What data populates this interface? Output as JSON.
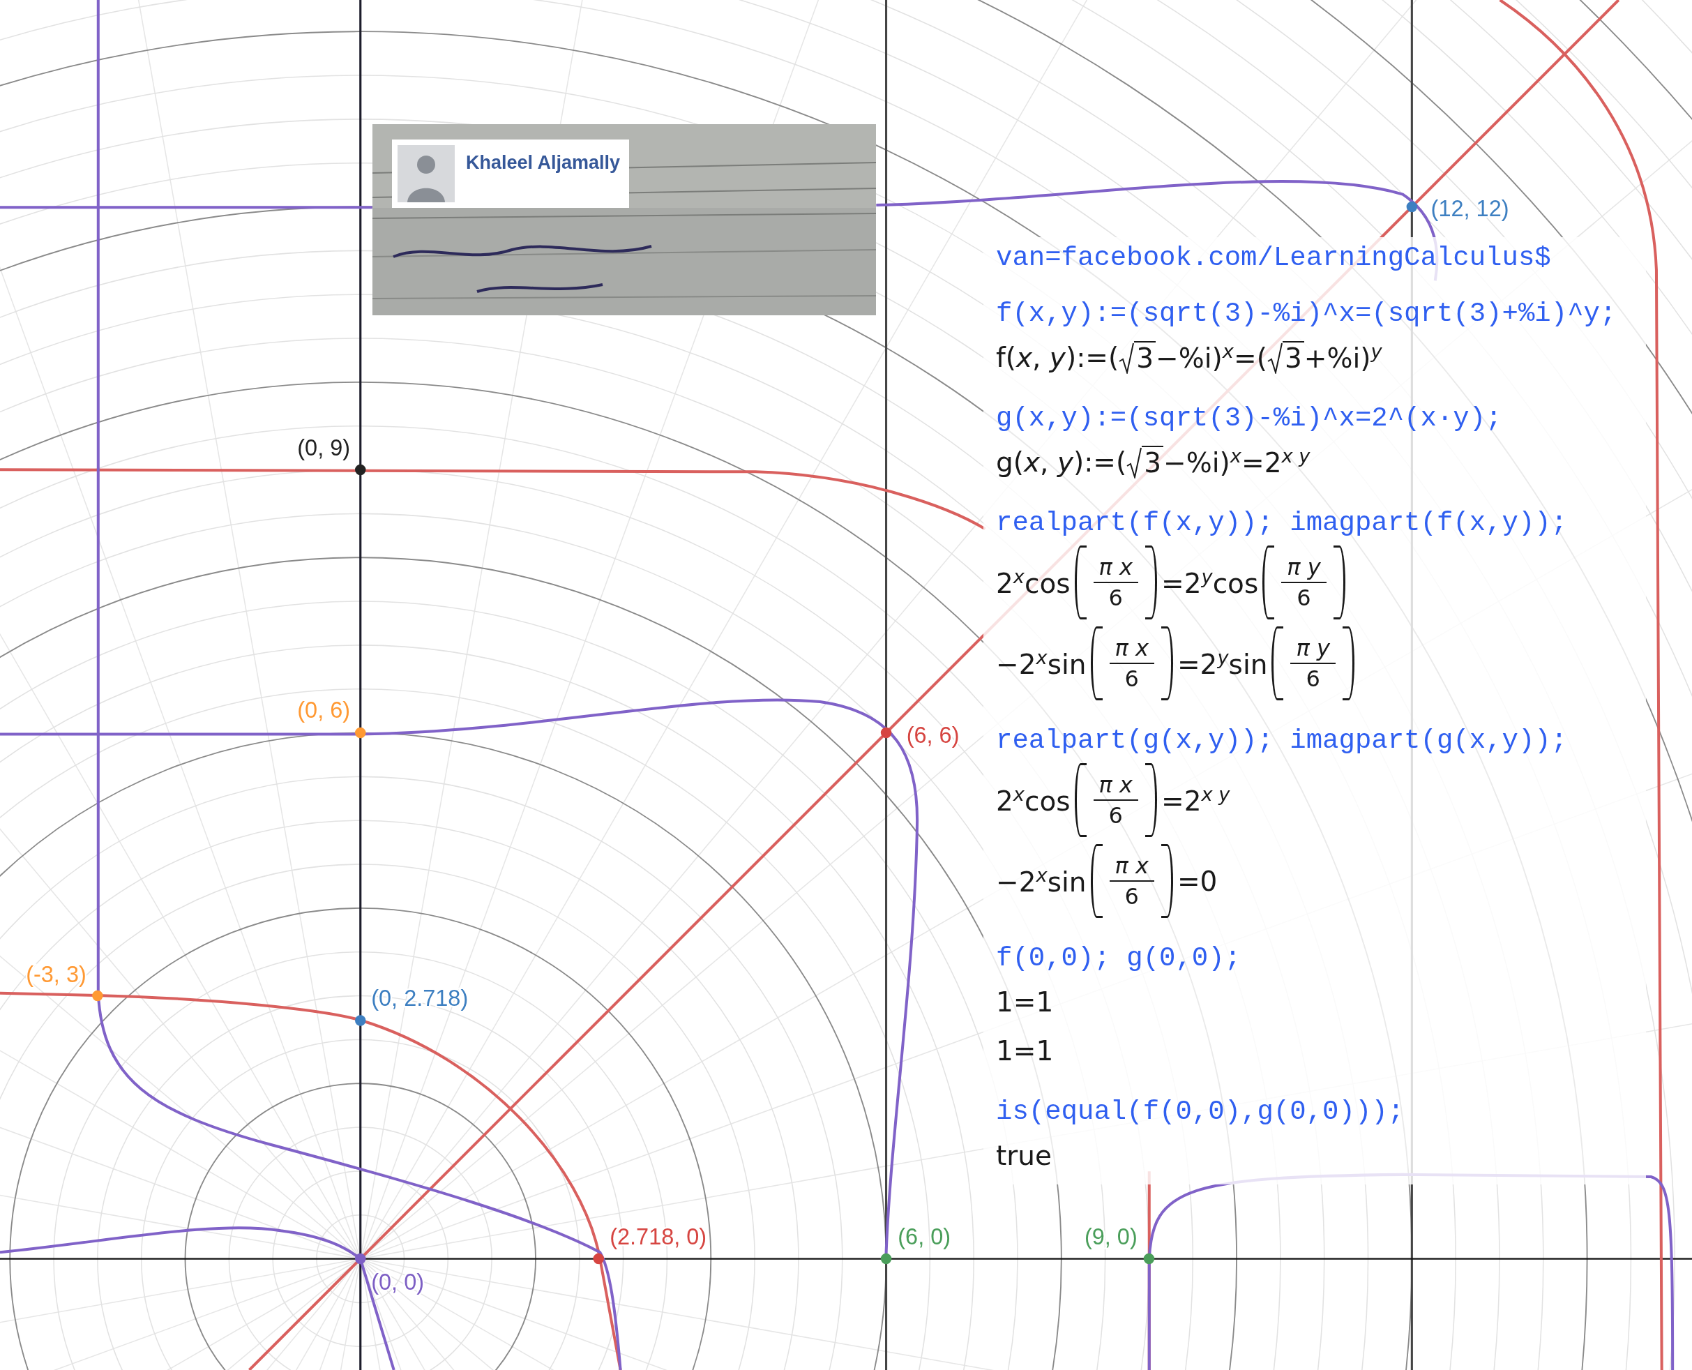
{
  "inset": {
    "kind": "picture",
    "author": {
      "name": "Khaleel Aljamally"
    }
  },
  "points": [
    {
      "label": "(0, 9)",
      "color": "#222222"
    },
    {
      "label": "(0, 6)",
      "color": "#ff9933"
    },
    {
      "label": "(6, 6)",
      "color": "#d64541"
    },
    {
      "label": "(12, 12)",
      "color": "#3d7fc1"
    },
    {
      "label": "(-3, 3)",
      "color": "#ff9933"
    },
    {
      "label": "(0, 2.718)",
      "color": "#3d7fc1"
    },
    {
      "label": "(2.718, 0)",
      "color": "#d64541"
    },
    {
      "label": "(0, 0)",
      "color": "#7d5fc4"
    },
    {
      "label": "(6, 0)",
      "color": "#4a9e5a"
    },
    {
      "label": "(9, 0)",
      "color": "#4a9e5a"
    }
  ],
  "session": [
    {
      "input": "van=facebook.com/LearningCalculus$"
    },
    {
      "input": "f(x,y):=(sqrt(3)-%i)^x=(sqrt(3)+%i)^y;",
      "outputs": [
        [
          {
            "kind": "text",
            "text": "f(*x*, *y*):=("
          },
          {
            "kind": "sqrt",
            "radicand": "3"
          },
          {
            "kind": "text",
            "text": "−%i)$^{x}$=("
          },
          {
            "kind": "sqrt",
            "radicand": "3"
          },
          {
            "kind": "text",
            "text": "+%i)$^{y}$"
          }
        ]
      ]
    },
    {
      "input": "g(x,y):=(sqrt(3)-%i)^x=2^(x·y);",
      "outputs": [
        [
          {
            "kind": "text",
            "text": "g(*x*, *y*):=("
          },
          {
            "kind": "sqrt",
            "radicand": "3"
          },
          {
            "kind": "text",
            "text": "−%i)$^{x}$=2$^{x y}$"
          }
        ]
      ]
    },
    {
      "input": "realpart(f(x,y)); imagpart(f(x,y));",
      "outputs": [
        [
          {
            "kind": "text",
            "text": "2$^{x}$cos"
          },
          {
            "kind": "frac",
            "num": "π x",
            "den": "6"
          },
          {
            "kind": "text",
            "text": "=2$^{y}$cos"
          },
          {
            "kind": "frac",
            "num": "π y",
            "den": "6"
          }
        ],
        [
          {
            "kind": "text",
            "text": "−2$^{x}$sin"
          },
          {
            "kind": "frac",
            "num": "π x",
            "den": "6"
          },
          {
            "kind": "text",
            "text": "=2$^{y}$sin"
          },
          {
            "kind": "frac",
            "num": "π y",
            "den": "6"
          }
        ]
      ]
    },
    {
      "input": "realpart(g(x,y)); imagpart(g(x,y));",
      "outputs": [
        [
          {
            "kind": "text",
            "text": "2$^{x}$cos"
          },
          {
            "kind": "frac",
            "num": "π x",
            "den": "6"
          },
          {
            "kind": "text",
            "text": "=2$^{x y}$"
          }
        ],
        [
          {
            "kind": "text",
            "text": "−2$^{x}$sin"
          },
          {
            "kind": "frac",
            "num": "π x",
            "den": "6"
          },
          {
            "kind": "text",
            "text": "=0"
          }
        ]
      ]
    },
    {
      "input": "f(0,0); g(0,0);",
      "outputs": [
        [
          {
            "kind": "text",
            "text": "1=1"
          }
        ],
        [
          {
            "kind": "text",
            "text": "1=1"
          }
        ]
      ]
    },
    {
      "input": "is(equal(f(0,0),g(0,0)));",
      "outputs": [
        [
          {
            "kind": "text",
            "text": "true"
          }
        ]
      ]
    }
  ]
}
